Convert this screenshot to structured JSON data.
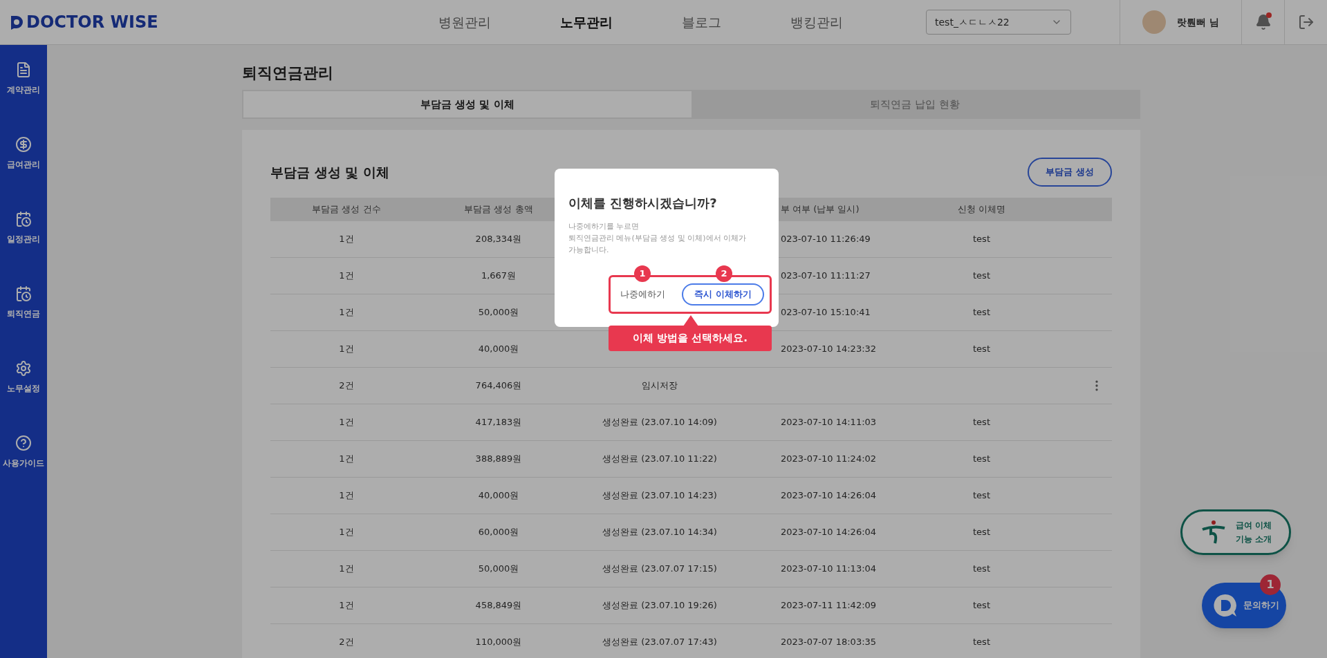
{
  "header": {
    "logo": "DOCTOR WISE",
    "nav": [
      {
        "label": "병원관리",
        "selected": false
      },
      {
        "label": "노무관리",
        "selected": true
      },
      {
        "label": "블로그",
        "selected": false
      },
      {
        "label": "뱅킹관리",
        "selected": false
      }
    ],
    "hospital_select": {
      "value": "test_ㅅㄷㄴㅅ22"
    },
    "user": {
      "name": "랏뤈뻐 님"
    },
    "notifications": {
      "unread": true
    }
  },
  "sidebar": {
    "items": [
      {
        "label": "계약관리",
        "kind": "document"
      },
      {
        "label": "급여관리",
        "kind": "coin"
      },
      {
        "label": "일정관리",
        "kind": "calendar"
      },
      {
        "label": "퇴직연금",
        "kind": "calendar"
      },
      {
        "label": "노무설정",
        "kind": "gear"
      },
      {
        "label": "사용가이드",
        "kind": "help"
      }
    ]
  },
  "page_title": "퇴직연금관리",
  "tabs": [
    {
      "label": "부담금 생성 및 이체",
      "selected": true
    },
    {
      "label": "퇴직연금 납입 현황",
      "selected": false
    }
  ],
  "card": {
    "title": "부담금 생성 및 이체",
    "create_button": "부담금 생성"
  },
  "table": {
    "columns": [
      {
        "label": "부담금 생성 건수"
      },
      {
        "label": "부담금 생성 총액"
      },
      {},
      {
        "label": "부 여부 (납부 일시)"
      },
      {
        "label": "신청 이체명"
      }
    ],
    "rows": [
      {
        "count": "1건",
        "total": "208,334원",
        "paid": "023-07-10 11:26:49",
        "name": "test"
      },
      {
        "count": "1건",
        "total": "1,667원",
        "paid": "023-07-10 11:11:27",
        "name": "test"
      },
      {
        "count": "1건",
        "total": "50,000원",
        "paid": "023-07-10 15:10:41",
        "name": "test"
      },
      {
        "count": "1건",
        "total": "40,000원",
        "paid": "2023-07-10 14:23:32",
        "name": "test"
      },
      {
        "count": "2건",
        "total": "764,406원",
        "status": "임시저장",
        "menu": true
      },
      {
        "count": "1건",
        "total": "417,183원",
        "status": "생성완료 (23.07.10 14:09)",
        "paid": "2023-07-10 14:11:03",
        "name": "test"
      },
      {
        "count": "1건",
        "total": "388,889원",
        "status": "생성완료 (23.07.10 11:22)",
        "paid": "2023-07-10 11:24:02",
        "name": "test"
      },
      {
        "count": "1건",
        "total": "40,000원",
        "status": "생성완료 (23.07.10 14:23)",
        "paid": "2023-07-10 14:26:04",
        "name": "test"
      },
      {
        "count": "1건",
        "total": "60,000원",
        "status": "생성완료 (23.07.10 14:34)",
        "paid": "2023-07-10 14:26:04",
        "name": "test"
      },
      {
        "count": "1건",
        "total": "50,000원",
        "status": "생성완료 (23.07.07 17:15)",
        "paid": "2023-07-10 11:13:04",
        "name": "test"
      },
      {
        "count": "1건",
        "total": "458,849원",
        "status": "생성완료 (23.07.10 19:26)",
        "paid": "2023-07-11 11:42:09",
        "name": "test"
      },
      {
        "count": "2건",
        "total": "110,000원",
        "status": "생성완료 (23.07.07 17:43)",
        "paid": "2023-07-07 18:03:35",
        "name": "test"
      }
    ]
  },
  "floating": {
    "transfer_intro": [
      "급여 이체",
      "기능 소개"
    ],
    "inquiry": "문의하기",
    "inquiry_badge": "1"
  },
  "dialog": {
    "title": "이체를 진행하시겠습니까?",
    "body": [
      "나중에하기를 누르면",
      "퇴직연금관리 메뉴(부담금 생성 및 이체)에서 이체가",
      "가능합니다."
    ],
    "later_button": "나중에하기",
    "transfer_button": "즉시 이체하기",
    "step_badges": [
      "1",
      "2"
    ],
    "hint": "이체 방법을 선택하세요."
  }
}
